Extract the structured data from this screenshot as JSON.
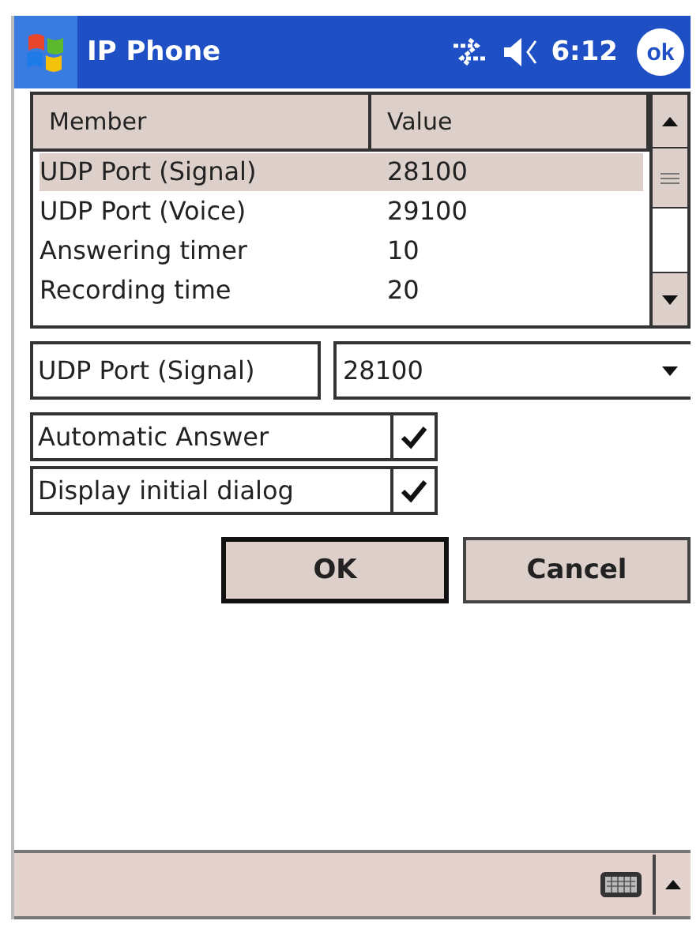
{
  "title_bar": {
    "title": "IP Phone",
    "time": "6:12",
    "ok_button": "ok"
  },
  "table": {
    "columns": [
      "Member",
      "Value"
    ],
    "rows": [
      {
        "member": "UDP Port (Signal)",
        "value": "28100",
        "selected": true
      },
      {
        "member": "UDP Port (Voice)",
        "value": "29100",
        "selected": false
      },
      {
        "member": "Answering timer",
        "value": "10",
        "selected": false
      },
      {
        "member": "Recording time",
        "value": "20",
        "selected": false
      }
    ]
  },
  "editor": {
    "label": "UDP Port (Signal)",
    "value": "28100"
  },
  "options": [
    {
      "label": "Automatic Answer",
      "checked": true
    },
    {
      "label": "Display initial dialog",
      "checked": true
    }
  ],
  "buttons": [
    {
      "label": "OK",
      "default": true
    },
    {
      "label": "Cancel",
      "default": false
    }
  ]
}
